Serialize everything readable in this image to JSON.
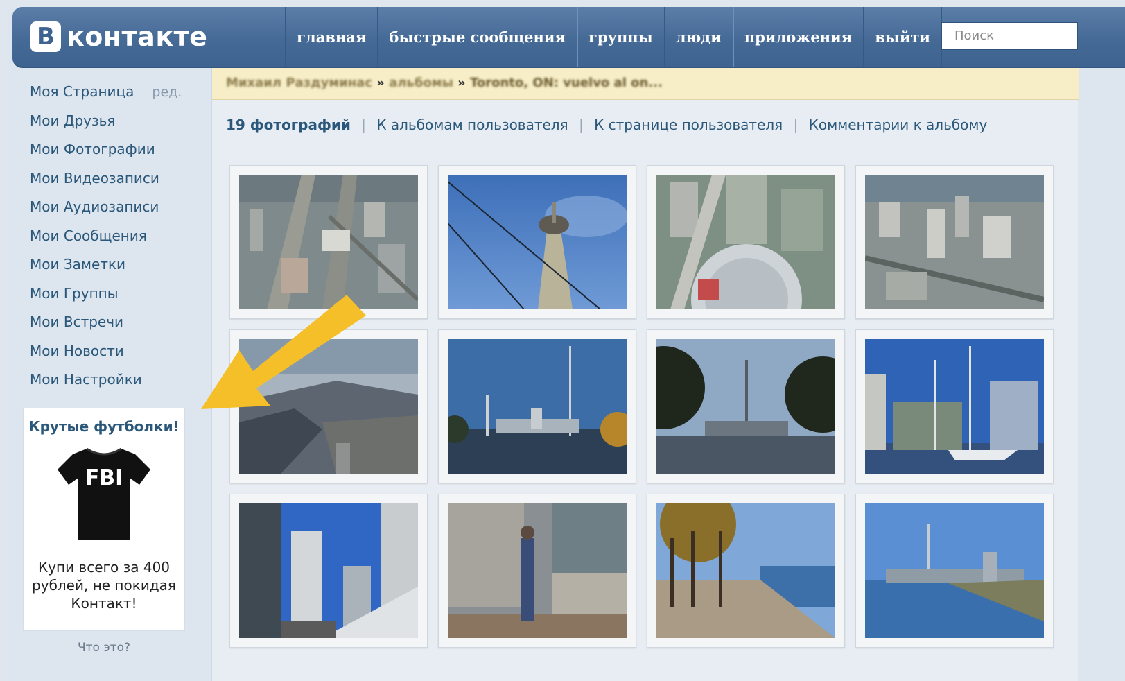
{
  "header": {
    "logo_letter": "В",
    "logo_text": "контакте",
    "nav": [
      "главная",
      "быстрые сообщения",
      "группы",
      "люди",
      "приложения",
      "выйти"
    ],
    "search_placeholder": "Поиск"
  },
  "sidebar": {
    "items": [
      {
        "label": "Моя Страница",
        "edit": "ред."
      },
      {
        "label": "Мои Друзья"
      },
      {
        "label": "Мои Фотографии"
      },
      {
        "label": "Мои Видеозаписи"
      },
      {
        "label": "Мои Аудиозаписи"
      },
      {
        "label": "Мои Сообщения"
      },
      {
        "label": "Мои Заметки"
      },
      {
        "label": "Мои Группы"
      },
      {
        "label": "Мои Встречи"
      },
      {
        "label": "Мои Новости"
      },
      {
        "label": "Мои Настройки"
      }
    ],
    "ad": {
      "title": "Крутые футболки!",
      "shirt_text": "FBI",
      "text": "Купи всего за 400 рублей, не покидая Контакт!",
      "what": "Что это?"
    }
  },
  "breadcrumb": {
    "user": "Михаил Раздуминас",
    "separator": "»",
    "albums": "альбомы",
    "current": "Toronto, ON: vuelvo al on..."
  },
  "tabs": {
    "count": "19 фотографий",
    "links": [
      "К альбомам пользователя",
      "К странице пользователя",
      "Комментарии к альбому"
    ]
  },
  "photos": [
    {
      "name": "aerial-city-grid"
    },
    {
      "name": "cn-tower-from-base"
    },
    {
      "name": "aerial-tower-top-view"
    },
    {
      "name": "aerial-downtown"
    },
    {
      "name": "aerial-waterfront"
    },
    {
      "name": "skyline-across-water"
    },
    {
      "name": "skyline-dusk-trees"
    },
    {
      "name": "harbour-sailboats"
    },
    {
      "name": "condo-towers-street"
    },
    {
      "name": "person-by-wall"
    },
    {
      "name": "lakeside-path-autumn"
    },
    {
      "name": "skyline-from-shore"
    }
  ],
  "colors": {
    "header": "#466a96",
    "link": "#2b587a",
    "breadcrumb_bg": "#f7eec8",
    "arrow": "#f5bf2a"
  }
}
